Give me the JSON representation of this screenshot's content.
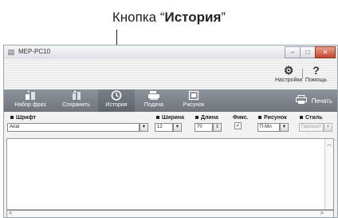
{
  "callout": {
    "prefix": "Кнопка “",
    "bold": "История",
    "suffix": "”"
  },
  "window": {
    "title": "MEP-PC10",
    "min_glyph": "–",
    "max_glyph": "□",
    "close_glyph": "✕"
  },
  "topbar": {
    "settings_label": "Настройки",
    "help_label": "Помощь",
    "settings_icon": "gear-icon",
    "help_icon": "question-icon",
    "help_glyph": "?"
  },
  "ribbon": {
    "buttons": [
      {
        "label": "Набор фраз",
        "icon": "phrase-set-icon"
      },
      {
        "label": "Сохранить",
        "icon": "save-icon"
      },
      {
        "label": "История",
        "icon": "history-clock-icon"
      },
      {
        "label": "Подача",
        "icon": "feed-icon"
      },
      {
        "label": "Рисунок",
        "icon": "picture-icon"
      }
    ],
    "print_label": "Печать"
  },
  "fields": {
    "font": {
      "label": "Шрифт",
      "value": "Arial"
    },
    "width": {
      "label": "Ширина",
      "value": "12"
    },
    "length": {
      "label": "Длина",
      "value": "70"
    },
    "fixed": {
      "label": "Фикс.",
      "checked": true
    },
    "pattern": {
      "label": "Рисунок",
      "value": "П-Мл"
    },
    "style": {
      "label": "Стиль",
      "value": "Горизонт"
    }
  },
  "colors": {
    "ribbon": "#7f858b",
    "background": "#f2f2f2"
  }
}
